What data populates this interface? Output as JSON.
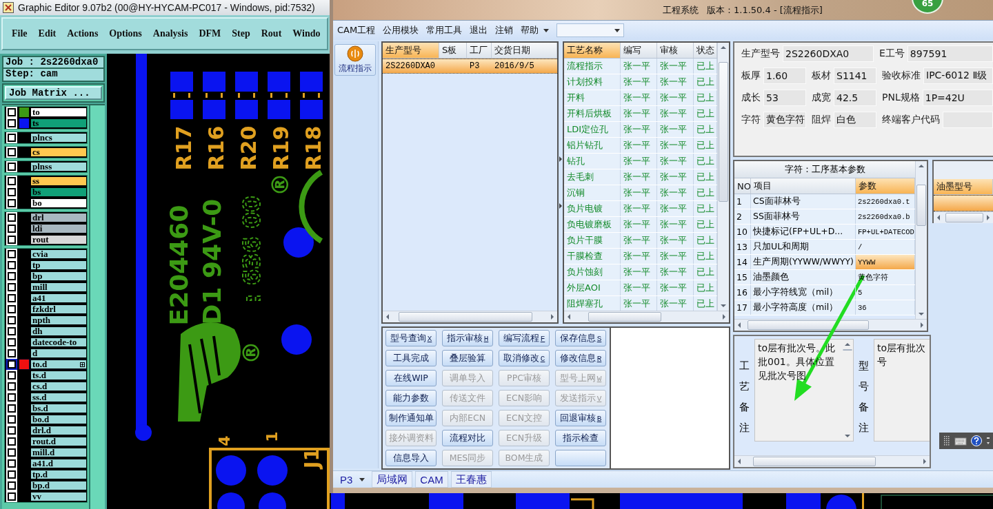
{
  "editor": {
    "title": "Graphic Editor 9.07b2 (00@HY-HYCAM-PC017 - Windows, pid:7532)",
    "menu": [
      "File",
      "Edit",
      "Actions",
      "Options",
      "Analysis",
      "DFM",
      "Step",
      "Rout",
      "Windo"
    ],
    "job": "Job : 2s2260dxa0",
    "step": "Step: cam",
    "matrix_button": "Job Matrix ...",
    "layer_groups": [
      [
        {
          "name": "to",
          "kind": "silk",
          "color": "#3c9a14",
          "checked": false,
          "selected": false
        },
        {
          "name": "ts",
          "kind": "mask",
          "color": "#0a14f0",
          "checked": false,
          "selected": false
        }
      ],
      [
        {
          "name": "plncs",
          "kind": "power",
          "checked": false,
          "selected": false
        }
      ],
      [
        {
          "name": "cs",
          "kind": "signal",
          "checked": false,
          "selected": false
        }
      ],
      [
        {
          "name": "plnss",
          "kind": "power",
          "checked": false,
          "selected": false
        }
      ],
      [
        {
          "name": "ss",
          "kind": "signal",
          "checked": false,
          "selected": false
        },
        {
          "name": "bs",
          "kind": "mask",
          "checked": false,
          "selected": false
        },
        {
          "name": "bo",
          "kind": "silk",
          "checked": false,
          "selected": false
        }
      ],
      [
        {
          "name": "drl",
          "kind": "drill",
          "checked": false,
          "selected": false
        },
        {
          "name": "ldi",
          "kind": "drill",
          "checked": false,
          "selected": false
        },
        {
          "name": "rout",
          "kind": "rout",
          "checked": false,
          "selected": false
        }
      ],
      [
        {
          "name": "cvia",
          "kind": "document",
          "checked": false,
          "selected": false
        },
        {
          "name": "tp",
          "kind": "document",
          "checked": false,
          "selected": false
        },
        {
          "name": "bp",
          "kind": "document",
          "checked": false,
          "selected": false
        },
        {
          "name": "mill",
          "kind": "document",
          "checked": false,
          "selected": false
        },
        {
          "name": "a41",
          "kind": "document",
          "checked": false,
          "selected": false
        },
        {
          "name": "fzkdrl",
          "kind": "document",
          "checked": false,
          "selected": false
        },
        {
          "name": "npth",
          "kind": "document",
          "checked": false,
          "selected": false
        },
        {
          "name": "dh",
          "kind": "document",
          "checked": false,
          "selected": false
        },
        {
          "name": "datecode-to",
          "kind": "document",
          "checked": false,
          "selected": false
        },
        {
          "name": "d",
          "kind": "document",
          "checked": false,
          "selected": false
        },
        {
          "name": "to.d",
          "kind": "document",
          "color": "#f01010",
          "checked": false,
          "selected": true
        },
        {
          "name": "ts.d",
          "kind": "document",
          "checked": false,
          "selected": false
        },
        {
          "name": "cs.d",
          "kind": "document",
          "checked": false,
          "selected": false
        },
        {
          "name": "ss.d",
          "kind": "document",
          "checked": false,
          "selected": false
        },
        {
          "name": "bs.d",
          "kind": "document",
          "checked": false,
          "selected": false
        },
        {
          "name": "bo.d",
          "kind": "document",
          "checked": false,
          "selected": false
        },
        {
          "name": "drl.d",
          "kind": "document",
          "checked": false,
          "selected": false
        },
        {
          "name": "rout.d",
          "kind": "document",
          "checked": false,
          "selected": false
        },
        {
          "name": "mill.d",
          "kind": "document",
          "checked": false,
          "selected": false
        },
        {
          "name": "a41.d",
          "kind": "document",
          "checked": false,
          "selected": false
        },
        {
          "name": "tp.d",
          "kind": "document",
          "checked": false,
          "selected": false
        },
        {
          "name": "bp.d",
          "kind": "document",
          "checked": false,
          "selected": false
        },
        {
          "name": "vv",
          "kind": "document",
          "checked": false,
          "selected": false
        }
      ]
    ],
    "canvas_labels": [
      "R17",
      "R16",
      "R20",
      "R19",
      "R18",
      "E204460",
      "D1 94V-0",
      ": 636 00",
      "®",
      "®",
      "4",
      "1",
      "J1"
    ]
  },
  "cam": {
    "title": "工程系统",
    "version": "版本：1.1.50.4 - [流程指示]",
    "badge": "65",
    "menu": [
      "CAM工程",
      "公用模块",
      "常用工具",
      "退出",
      "注销",
      "帮助"
    ],
    "rail_button": "流程指示",
    "jobs": {
      "columns": [
        {
          "label": "生产型号",
          "selected": true
        },
        {
          "label": "S板",
          "selected": false
        },
        {
          "label": "工厂",
          "selected": false
        },
        {
          "label": "交货日期",
          "selected": false
        }
      ],
      "rows": [
        {
          "cells": [
            "2S2260DXA0",
            null,
            "P3",
            "2016/9/5"
          ],
          "selected": true
        }
      ]
    },
    "process": {
      "columns": [
        {
          "label": "工艺名称",
          "selected": true
        },
        {
          "label": "编写",
          "selected": false
        },
        {
          "label": "审核",
          "selected": false
        },
        {
          "label": "状态",
          "selected": false
        }
      ],
      "rows": [
        [
          "流程指示",
          "张一平",
          "张一平",
          "已上"
        ],
        [
          "计划投料",
          "张一平",
          "张一平",
          "已上"
        ],
        [
          "开料",
          "张一平",
          "张一平",
          "已上"
        ],
        [
          "开料后烘板",
          "张一平",
          "张一平",
          "已上"
        ],
        [
          "LDI定位孔",
          "张一平",
          "张一平",
          "已上"
        ],
        [
          "铝片钻孔",
          "张一平",
          "张一平",
          "已上"
        ],
        [
          "钻孔",
          "张一平",
          "张一平",
          "已上"
        ],
        [
          "去毛刺",
          "张一平",
          "张一平",
          "已上"
        ],
        [
          "沉铜",
          "张一平",
          "张一平",
          "已上"
        ],
        [
          "负片电镀",
          "张一平",
          "张一平",
          "已上"
        ],
        [
          "负电镀磨板",
          "张一平",
          "张一平",
          "已上"
        ],
        [
          "负片干膜",
          "张一平",
          "张一平",
          "已上"
        ],
        [
          "干膜检查",
          "张一平",
          "张一平",
          "已上"
        ],
        [
          "负片蚀刻",
          "张一平",
          "张一平",
          "已上"
        ],
        [
          "外层AOI",
          "张一平",
          "张一平",
          "已上"
        ],
        [
          "阻焊塞孔",
          "张一平",
          "张一平",
          "已上"
        ]
      ]
    },
    "info": [
      [
        {
          "label": "生产型号",
          "value": "2S2260DXA0"
        },
        {
          "label": "E工号",
          "value": "897591"
        }
      ],
      [
        {
          "label": "板厚",
          "value": "1.60"
        },
        {
          "label": "板材",
          "value": "S1141"
        },
        {
          "label": "验收标准",
          "value": "IPC-6012 Ⅱ级"
        }
      ],
      [
        {
          "label": "成长",
          "value": "53"
        },
        {
          "label": "成宽",
          "value": "42.5"
        },
        {
          "label": "PNL规格",
          "value": "1P=42U"
        }
      ],
      [
        {
          "label": "字符",
          "value": "黄色字符"
        },
        {
          "label": "阻焊",
          "value": "白色"
        },
        {
          "label": "终端客户代码"
        }
      ]
    ],
    "params": {
      "title": "字符：工序基本参数",
      "columns": [
        {
          "label": "NO",
          "selected": false
        },
        {
          "label": "项目",
          "selected": false
        },
        {
          "label": "参数",
          "selected": true
        }
      ],
      "rows": [
        {
          "cells": [
            "1",
            "CS面菲林号",
            "2s2260dxa0.t"
          ],
          "selected": false
        },
        {
          "cells": [
            "2",
            "SS面菲林号",
            "2s2260dxa0.b"
          ],
          "selected": false
        },
        {
          "cells": [
            "10",
            "快捷标记(FP+UL+D...",
            "FP+UL+DATECOD"
          ],
          "selected": false
        },
        {
          "cells": [
            "13",
            "只加UL和周期",
            "/"
          ],
          "selected": false
        },
        {
          "cells": [
            "14",
            "生产周期(YYWW/WWYY)",
            "YYWW"
          ],
          "selected": true
        },
        {
          "cells": [
            "15",
            "油墨颜色",
            "黄色字符"
          ],
          "selected": false
        },
        {
          "cells": [
            "16",
            "最小字符线宽（mil）",
            "5"
          ],
          "selected": false
        },
        {
          "cells": [
            "17",
            "最小字符高度（mil）",
            "36"
          ],
          "selected": false
        }
      ]
    },
    "ink": {
      "columns": [
        {
          "label": "油墨型号",
          "selected": true
        }
      ],
      "rows": [
        {
          "selected": true
        }
      ]
    },
    "buttons": [
      {
        "label": "型号查询",
        "key": "X",
        "disabled": false
      },
      {
        "label": "指示审核",
        "key": "H",
        "disabled": false
      },
      {
        "label": "编写流程",
        "key": "F",
        "disabled": false
      },
      {
        "label": "保存信息",
        "key": "S",
        "disabled": false
      },
      {
        "label": "工具完成",
        "disabled": false
      },
      {
        "label": "叠层验算",
        "disabled": false
      },
      {
        "label": "取消修改",
        "key": "C",
        "disabled": false
      },
      {
        "label": "修改信息",
        "key": "R",
        "disabled": false
      },
      {
        "label": "在线WIP",
        "disabled": false
      },
      {
        "label": "调单导入",
        "disabled": true
      },
      {
        "label": "PPC审核",
        "disabled": true
      },
      {
        "label": "型号上网",
        "key": "W",
        "disabled": true
      },
      {
        "label": "能力参数",
        "disabled": false
      },
      {
        "label": "传送文件",
        "disabled": true
      },
      {
        "label": "ECN影响",
        "disabled": true
      },
      {
        "label": "发送指示",
        "key": "V",
        "disabled": true
      },
      {
        "label": "制作通知单",
        "disabled": false
      },
      {
        "label": "内部ECN",
        "disabled": true
      },
      {
        "label": "ECN文控",
        "disabled": true
      },
      {
        "label": "回退审核",
        "key": "B",
        "disabled": false
      },
      {
        "label": "接外调资料",
        "disabled": true
      },
      {
        "label": "流程对比",
        "disabled": false
      },
      {
        "label": "ECN升级",
        "disabled": true
      },
      {
        "label": "指示检查",
        "disabled": false
      },
      {
        "label": "信息导入",
        "disabled": false
      },
      {
        "label": "MES同步",
        "disabled": true
      },
      {
        "label": "BOM生成",
        "disabled": true
      },
      {
        "disabled": false
      }
    ],
    "remarks": [
      {
        "label": "工艺备注",
        "text": "to层有批次号。此批001。具体位置见批次号图"
      },
      {
        "label": "型号备注",
        "text": "to层有批次号"
      }
    ],
    "status_bar": {
      "factory": "P3",
      "items": [
        "局域网",
        "CAM",
        "王春惠"
      ]
    }
  }
}
